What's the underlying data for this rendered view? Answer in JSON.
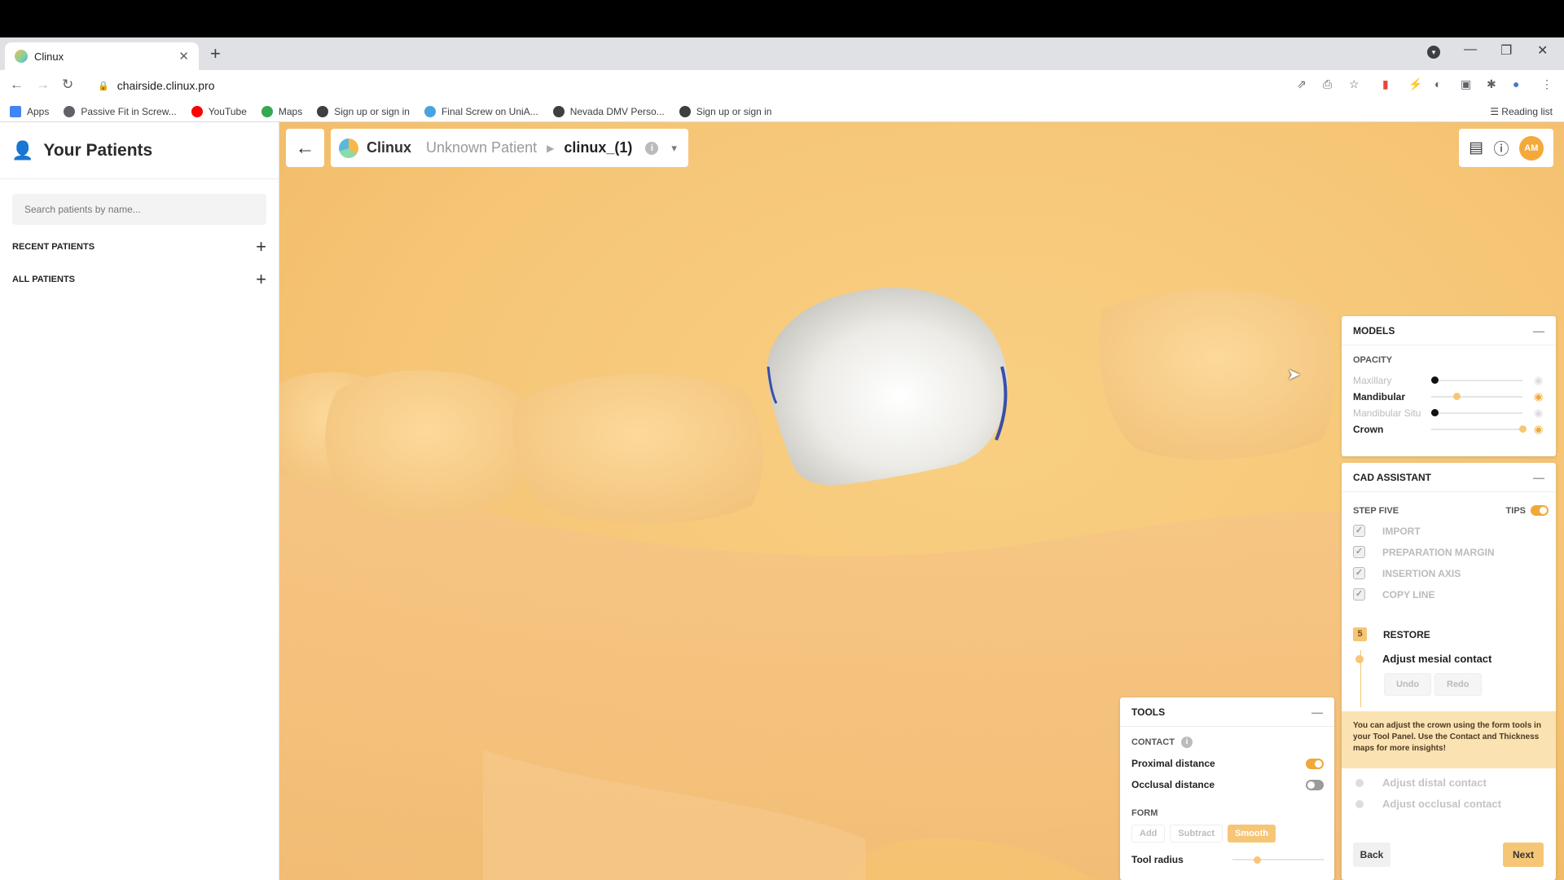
{
  "browser": {
    "tab_title": "Clinux",
    "url": "chairside.clinux.pro",
    "bookmarks": [
      {
        "label": "Apps",
        "icon": "apps-grid-icon",
        "color": "#4285f4"
      },
      {
        "label": "Passive Fit in Screw...",
        "icon": "screw-site-icon",
        "color": "#5f6368"
      },
      {
        "label": "YouTube",
        "icon": "youtube-icon",
        "color": "#ff0000"
      },
      {
        "label": "Maps",
        "icon": "maps-pin-icon",
        "color": "#34a853"
      },
      {
        "label": "Sign up or sign in",
        "icon": "globe-icon",
        "color": "#3c4043"
      },
      {
        "label": "Final Screw on UniA...",
        "icon": "cloud-icon",
        "color": "#4aa3df"
      },
      {
        "label": "Nevada DMV Perso...",
        "icon": "globe-icon",
        "color": "#3c4043"
      },
      {
        "label": "Sign up or sign in",
        "icon": "globe-icon",
        "color": "#3c4043"
      }
    ],
    "reading_list": "Reading list"
  },
  "sidebar": {
    "title": "Your Patients",
    "search_placeholder": "Search patients by name...",
    "recent_label": "RECENT PATIENTS",
    "all_label": "ALL PATIENTS"
  },
  "header": {
    "brand": "Clinux",
    "patient": "Unknown Patient",
    "file": "clinux_(1)",
    "avatar_initials": "AM"
  },
  "models": {
    "title": "MODELS",
    "opacity_label": "OPACITY",
    "rows": [
      {
        "label": "Maxillary",
        "value": 0.0,
        "active": false
      },
      {
        "label": "Mandibular",
        "value": 0.25,
        "active": true
      },
      {
        "label": "Mandibular Situ",
        "value": 0.0,
        "active": false
      },
      {
        "label": "Crown",
        "value": 1.0,
        "active": true
      }
    ]
  },
  "cad": {
    "title": "CAD ASSISTANT",
    "step_label": "STEP FIVE",
    "tips_label": "TIPS",
    "steps_done": [
      "IMPORT",
      "PREPARATION MARGIN",
      "INSERTION AXIS",
      "COPY LINE"
    ],
    "current_num": "5",
    "current_step": "RESTORE",
    "substep_active": "Adjust mesial contact",
    "undo": "Undo",
    "redo": "Redo",
    "tip_text_parts": [
      "You can adjust the crown using the form tools in your ",
      "Tool Panel",
      ". Use the ",
      "Contact",
      " and ",
      "Thickness",
      " maps for more insights!"
    ],
    "substeps_pending": [
      "Adjust distal contact",
      "Adjust occlusal contact"
    ],
    "back": "Back",
    "next": "Next"
  },
  "tools": {
    "title": "TOOLS",
    "contact_label": "CONTACT",
    "proximal": "Proximal distance",
    "occlusal": "Occlusal distance",
    "proximal_on": true,
    "occlusal_on": false,
    "form_label": "FORM",
    "form_buttons": [
      "Add",
      "Subtract",
      "Smooth"
    ],
    "active_form": "Smooth",
    "radius_label": "Tool radius",
    "radius_value": 0.25
  },
  "colors": {
    "accent": "#f0a83a",
    "viewport_bg": "#f6c677"
  }
}
